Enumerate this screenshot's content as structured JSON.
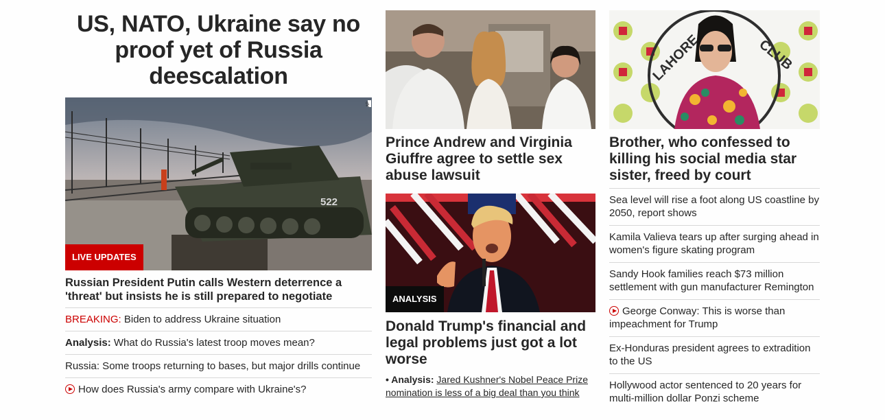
{
  "lead": {
    "headline": "US, NATO, Ukraine say no proof yet of Russia deescalation",
    "badge": "LIVE UPDATES",
    "photo_credit": "AP",
    "tank_number": "522",
    "subhead": "Russian President Putin calls Western deterrence a 'threat' but insists he is still prepared to negotiate",
    "items": [
      {
        "prefix": "BREAKING:",
        "text": " Biden to address Ukraine situation"
      },
      {
        "prefix": "Analysis:",
        "text": " What do Russia's latest troop moves mean?"
      },
      {
        "text": "Russia: Some troops returning to bases, but major drills continue"
      },
      {
        "text": "How does Russia's army compare with Ukraine's?",
        "icon": "play-icon"
      }
    ]
  },
  "story_andrew": {
    "headline": "Prince Andrew and Virginia Giuffre agree to settle sex abuse lawsuit"
  },
  "story_trump": {
    "badge": "ANALYSIS",
    "headline": "Donald Trump's financial and legal problems just got a lot worse",
    "related_prefix": "• Analysis:",
    "related_link": "Jared Kushner's Nobel Peace Prize nomination is less of a big deal than you think"
  },
  "story_qandeel": {
    "headline": "Brother, who confessed to killing his social media star sister, freed by court",
    "banner_text": "LAHORE PRESS CLUB",
    "items": [
      {
        "text": "Sea level will rise a foot along US coastline by 2050, report shows"
      },
      {
        "text": "Kamila Valieva tears up after surging ahead in women's figure skating program"
      },
      {
        "text": "Sandy Hook families reach $73 million settlement with gun manufacturer Remington"
      },
      {
        "text": "George Conway: This is worse than impeachment for Trump",
        "icon": "play-icon"
      },
      {
        "text": "Ex-Honduras president agrees to extradition to the US"
      },
      {
        "text": "Hollywood actor sentenced to 20 years for multi-million dollar Ponzi scheme"
      }
    ]
  },
  "colors": {
    "accent_red": "#cc0000",
    "text": "#262626",
    "divider": "#d8d8d8"
  }
}
